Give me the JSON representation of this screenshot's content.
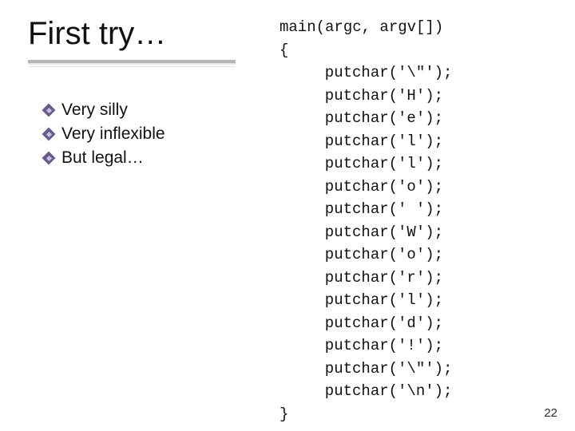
{
  "title": "First try…",
  "bullets": [
    {
      "text": "Very silly"
    },
    {
      "text": "Very inflexible"
    },
    {
      "text": "But legal…"
    }
  ],
  "code": {
    "lines": [
      "main(argc, argv[])",
      "{",
      "  putchar('\\\"');",
      "  putchar('H');",
      "  putchar('e');",
      "  putchar('l');",
      "  putchar('l');",
      "  putchar('o');",
      "  putchar(' ');",
      "  putchar('W');",
      "  putchar('o');",
      "  putchar('r');",
      "  putchar('l');",
      "  putchar('d');",
      "  putchar('!');",
      "  putchar('\\\"');",
      "  putchar('\\n');",
      "}"
    ]
  },
  "page_number": "22"
}
